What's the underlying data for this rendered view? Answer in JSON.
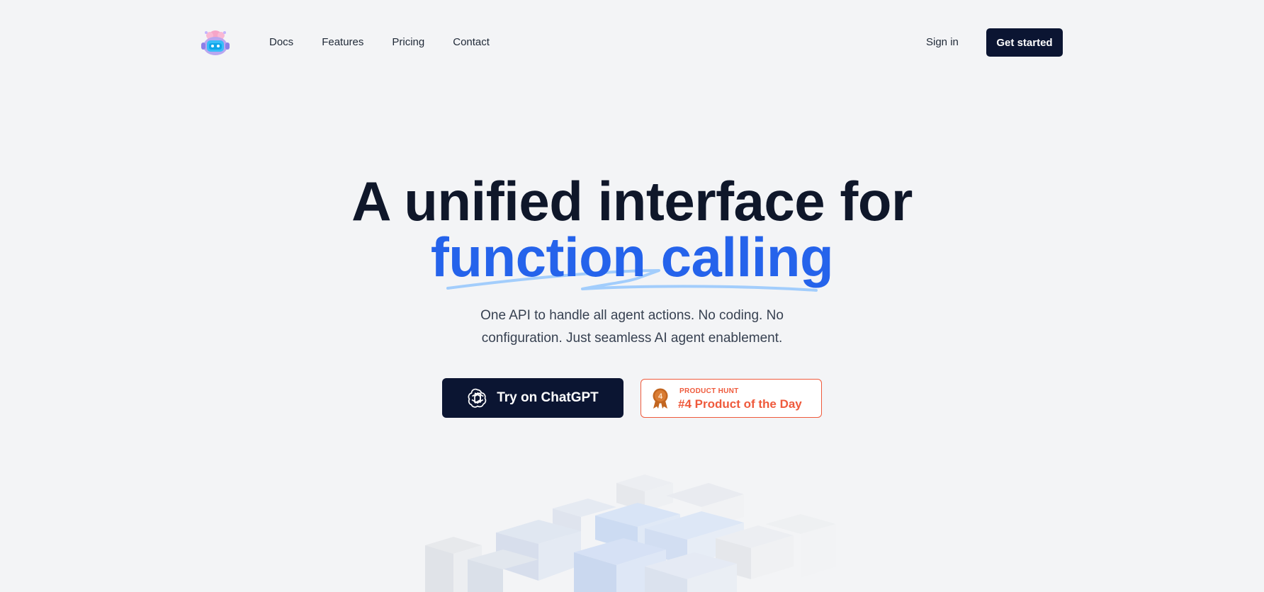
{
  "nav": {
    "logo_icon": "robot-mascot-icon",
    "links": [
      "Docs",
      "Features",
      "Pricing",
      "Contact"
    ],
    "signin_label": "Sign in",
    "cta_label": "Get started"
  },
  "hero": {
    "headline_line1": "A unified interface for",
    "headline_line2": "function calling",
    "subtitle_line1": "One API to handle all agent actions. No coding. No",
    "subtitle_line2": "configuration. Just seamless AI agent enablement.",
    "primary_button_label": "Try on ChatGPT",
    "primary_button_icon": "openai-logo-icon",
    "badge": {
      "kicker": "PRODUCT HUNT",
      "title": "#4 Product of the Day",
      "medal_number": "4",
      "medal_icon": "medal-icon"
    }
  },
  "colors": {
    "background": "#f3f4f6",
    "dark_navy": "#0b1532",
    "accent_blue": "#2563eb",
    "product_hunt_orange": "#ef5a3c"
  }
}
